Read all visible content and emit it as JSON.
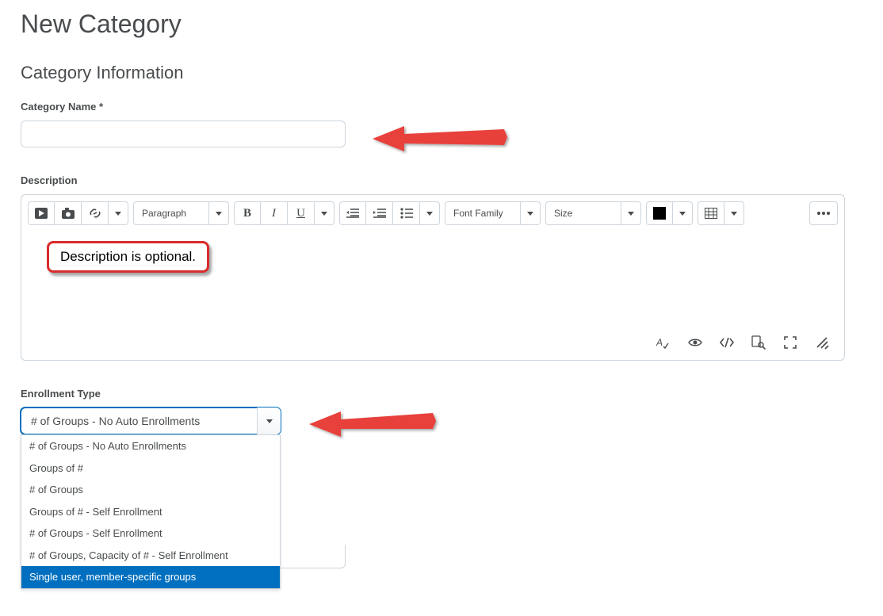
{
  "page": {
    "title": "New Category",
    "section_title": "Category Information"
  },
  "fields": {
    "category_name_label": "Category Name *",
    "description_label": "Description",
    "enrollment_label": "Enrollment Type"
  },
  "editor": {
    "paragraph": "Paragraph",
    "font_family": "Font Family",
    "size": "Size",
    "callout_text": "Description is optional."
  },
  "enrollment": {
    "selected": "# of Groups - No Auto Enrollments",
    "options": [
      "# of Groups - No Auto Enrollments",
      "Groups of #",
      "# of Groups",
      "Groups of # - Self Enrollment",
      "# of Groups - Self Enrollment",
      "# of Groups, Capacity of # - Self Enrollment",
      "Single user, member-specific groups"
    ],
    "highlight_index": 6
  }
}
